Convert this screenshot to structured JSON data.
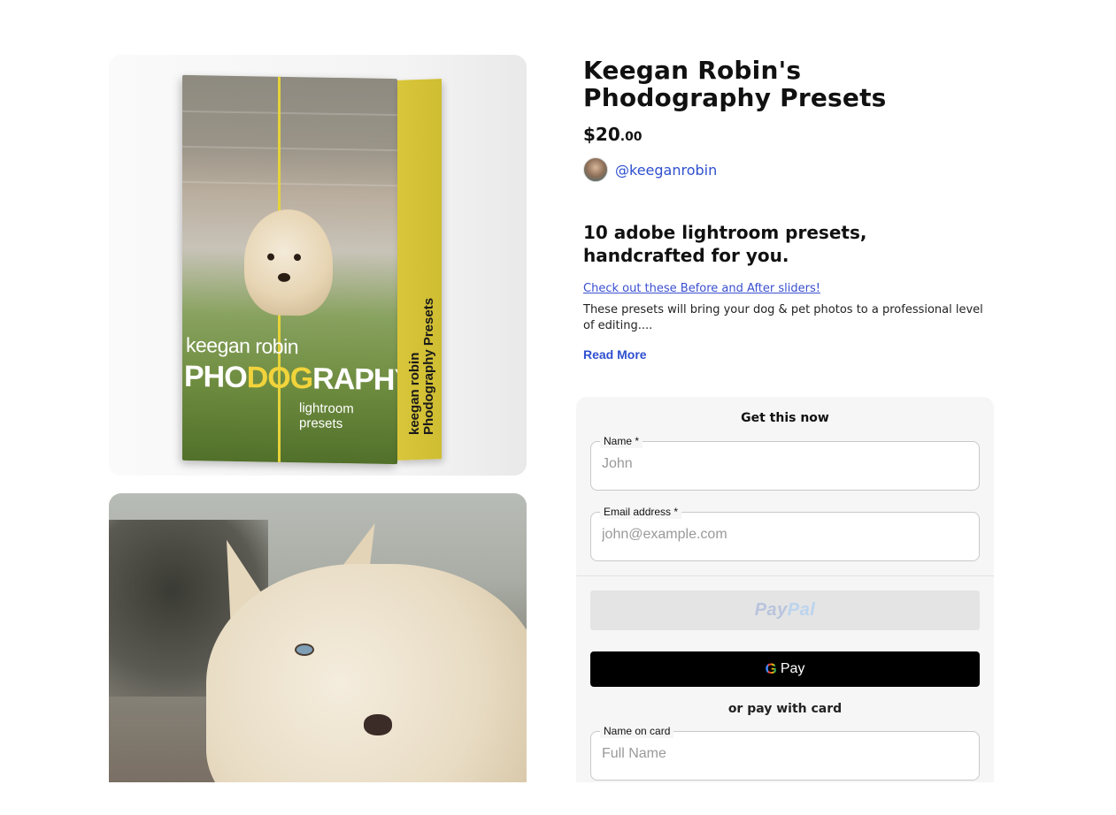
{
  "product": {
    "title": "Keegan Robin's Phodography Presets",
    "price_main": "$20",
    "price_cents": ".00",
    "creator_handle": "@keeganrobin",
    "headline": "10 adobe lightroom presets, handcrafted for you.",
    "slider_link": "Check out these Before and After sliders!",
    "description": "These presets will bring your dog & pet photos to a professional level of editing....",
    "read_more": "Read More"
  },
  "box_art": {
    "brand": "keegan robin",
    "title_pre": "PHO",
    "title_hl": "DOG",
    "title_post": "RAPHY",
    "subtitle": "lightroom presets",
    "side_line1": "keegan robin",
    "side_line2": "Phodography Presets"
  },
  "checkout": {
    "heading": "Get this now",
    "name_label": "Name *",
    "name_placeholder": "John",
    "email_label": "Email address *",
    "email_placeholder": "john@example.com",
    "paypal_pay": "Pay",
    "paypal_pal": "Pal",
    "gpay_g": "G",
    "gpay_label": "Pay",
    "or_card": "or pay with card",
    "card_name_label": "Name on card",
    "card_name_placeholder": "Full Name"
  },
  "colors": {
    "accent_link": "#2f4fcf",
    "box_yellow": "#f1d33b",
    "checkout_bg": "#f6f6f6",
    "gpay_bg": "#000000"
  }
}
